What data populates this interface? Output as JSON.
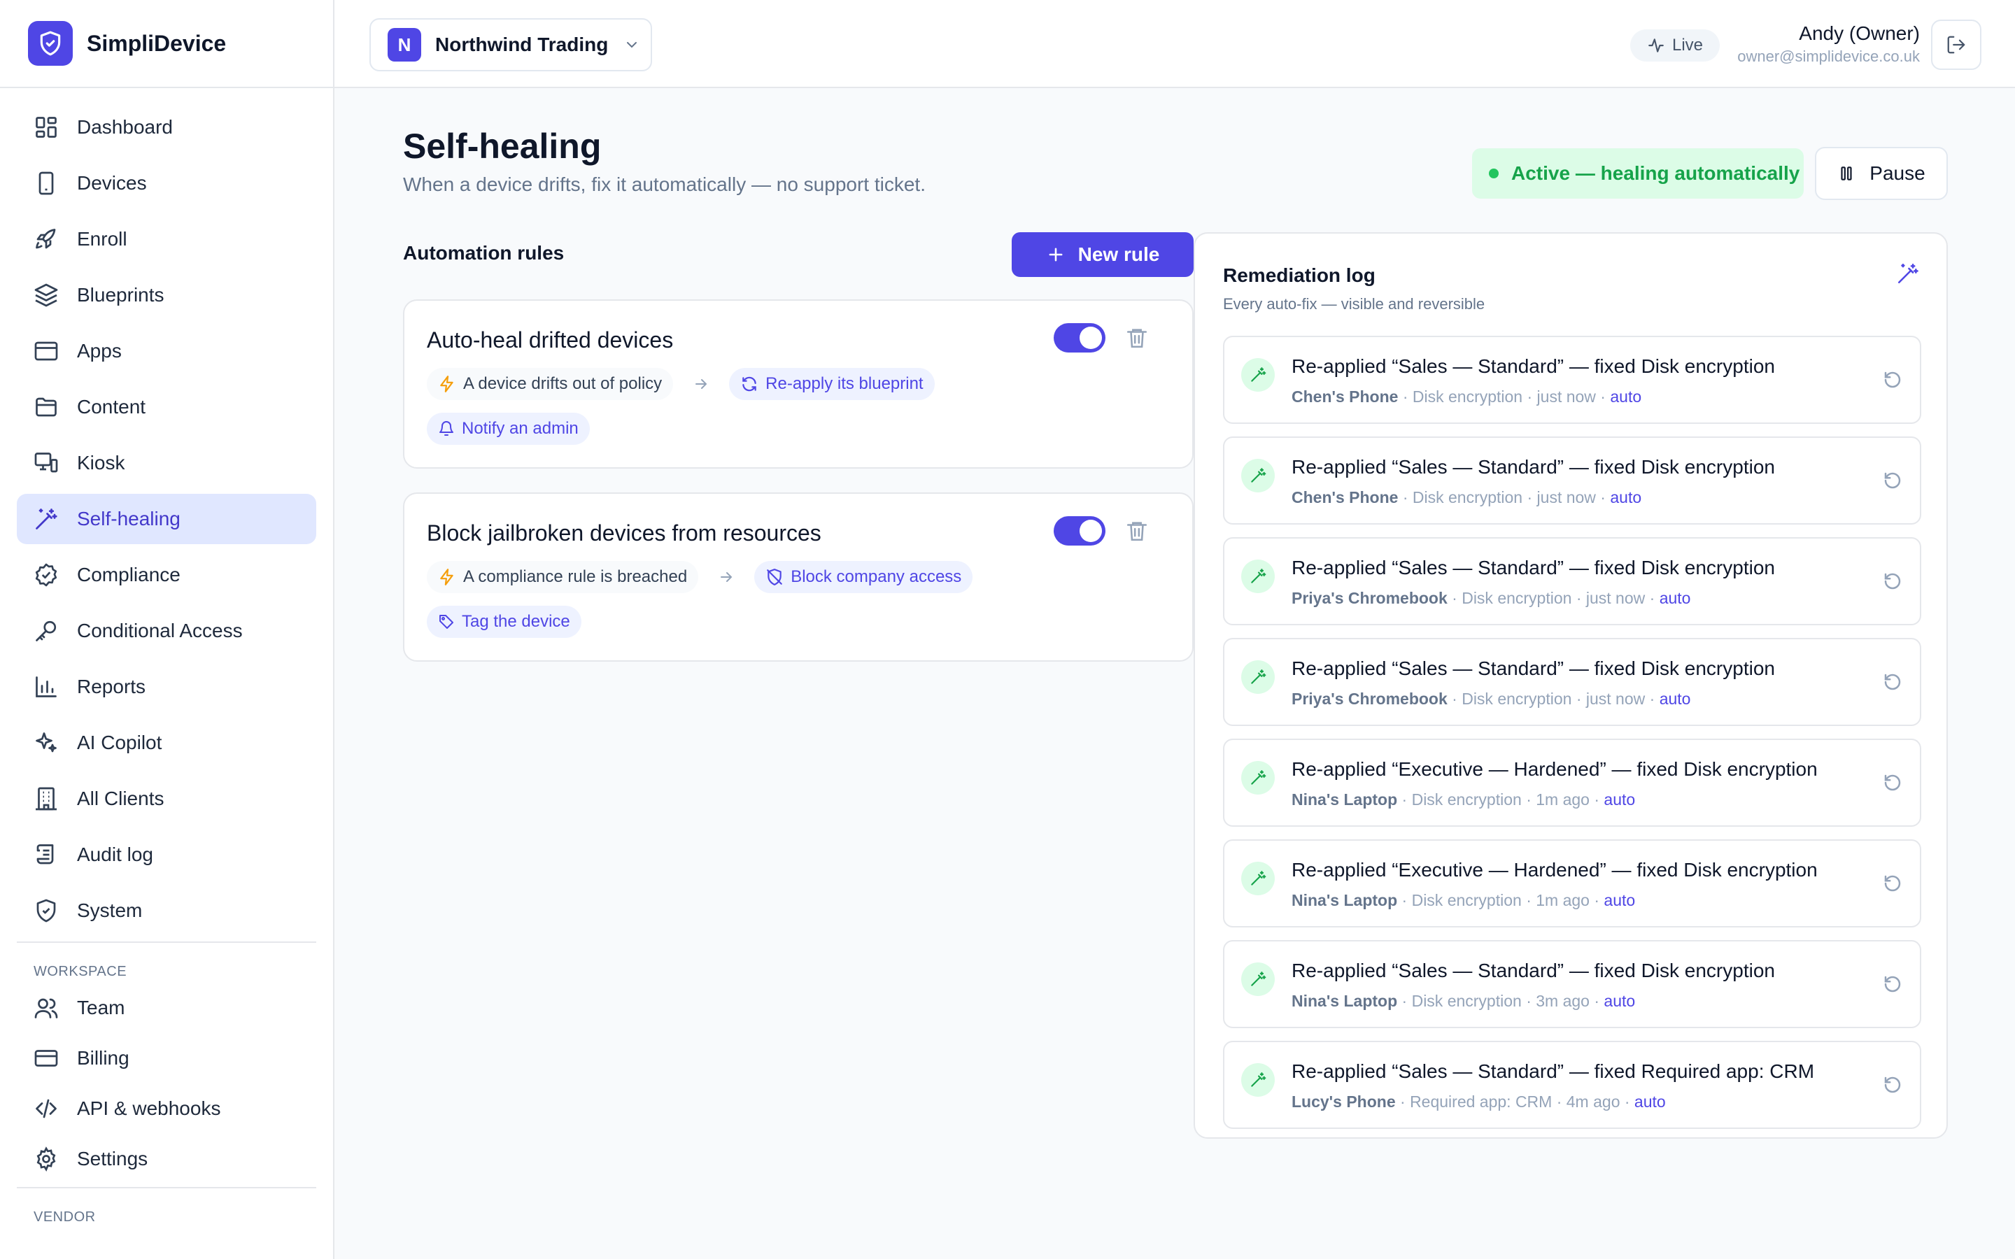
{
  "brand": {
    "name": "SimpliDevice"
  },
  "sidebar": {
    "items": [
      {
        "label": "Dashboard",
        "icon": "dashboard-icon"
      },
      {
        "label": "Devices",
        "icon": "device-icon"
      },
      {
        "label": "Enroll",
        "icon": "rocket-icon"
      },
      {
        "label": "Blueprints",
        "icon": "layers-icon"
      },
      {
        "label": "Apps",
        "icon": "window-icon"
      },
      {
        "label": "Content",
        "icon": "folder-icon"
      },
      {
        "label": "Kiosk",
        "icon": "kiosk-icon"
      },
      {
        "label": "Self-healing",
        "icon": "wand-icon",
        "active": true
      },
      {
        "label": "Compliance",
        "icon": "check-badge-icon"
      },
      {
        "label": "Conditional Access",
        "icon": "key-icon"
      },
      {
        "label": "Reports",
        "icon": "bar-chart-icon"
      },
      {
        "label": "AI Copilot",
        "icon": "sparkles-icon"
      },
      {
        "label": "All Clients",
        "icon": "building-icon"
      },
      {
        "label": "Audit log",
        "icon": "scroll-icon"
      },
      {
        "label": "System",
        "icon": "shield-check-icon"
      }
    ],
    "workspace_label": "WORKSPACE",
    "workspace_items": [
      {
        "label": "Team",
        "icon": "users-icon"
      },
      {
        "label": "Billing",
        "icon": "credit-card-icon"
      },
      {
        "label": "API & webhooks",
        "icon": "code-icon"
      },
      {
        "label": "Settings",
        "icon": "gear-icon"
      }
    ],
    "vendor_label": "VENDOR"
  },
  "header": {
    "org_initial": "N",
    "org_name": "Northwind Trading",
    "live_label": "Live",
    "user_name": "Andy (Owner)",
    "user_email": "owner@simplidevice.co.uk"
  },
  "page": {
    "title": "Self-healing",
    "subtitle": "When a device drifts, fix it automatically — no support ticket.",
    "status_label": "Active — healing automatically",
    "pause_label": "Pause"
  },
  "rules": {
    "header": "Automation rules",
    "new_rule_label": "New rule",
    "items": [
      {
        "title": "Auto-heal drifted devices",
        "enabled": true,
        "trigger": "A device drifts out of policy",
        "action1": "Re-apply its blueprint",
        "action2": "Notify an admin"
      },
      {
        "title": "Block jailbroken devices from resources",
        "enabled": true,
        "trigger": "A compliance rule is breached",
        "action1": "Block company access",
        "action2": "Tag the device"
      }
    ]
  },
  "log": {
    "title": "Remediation log",
    "subtitle": "Every auto-fix — visible and reversible",
    "items": [
      {
        "text": "Re-applied “Sales — Standard” — fixed Disk encryption",
        "device": "Chen's Phone",
        "detail": " · Disk encryption · just now · ",
        "tag": "auto"
      },
      {
        "text": "Re-applied “Sales — Standard” — fixed Disk encryption",
        "device": "Chen's Phone",
        "detail": " · Disk encryption · just now · ",
        "tag": "auto"
      },
      {
        "text": "Re-applied “Sales — Standard” — fixed Disk encryption",
        "device": "Priya's Chromebook",
        "detail": " · Disk encryption · just now · ",
        "tag": "auto"
      },
      {
        "text": "Re-applied “Sales — Standard” — fixed Disk encryption",
        "device": "Priya's Chromebook",
        "detail": " · Disk encryption · just now · ",
        "tag": "auto"
      },
      {
        "text": "Re-applied “Executive — Hardened” — fixed Disk encryption",
        "device": "Nina's Laptop",
        "detail": " · Disk encryption · 1m ago · ",
        "tag": "auto"
      },
      {
        "text": "Re-applied “Executive — Hardened” — fixed Disk encryption",
        "device": "Nina's Laptop",
        "detail": " · Disk encryption · 1m ago · ",
        "tag": "auto"
      },
      {
        "text": "Re-applied “Sales — Standard” — fixed Disk encryption",
        "device": "Nina's Laptop",
        "detail": " · Disk encryption · 3m ago · ",
        "tag": "auto"
      },
      {
        "text": "Re-applied “Sales — Standard” — fixed Required app: CRM",
        "device": "Lucy's Phone",
        "detail": " · Required app: CRM · 4m ago · ",
        "tag": "auto"
      }
    ]
  },
  "colors": {
    "accent": "#4f46e5",
    "success": "#16a34a",
    "success_bg": "#dcfce7",
    "active_nav_bg": "#e0e7ff"
  }
}
